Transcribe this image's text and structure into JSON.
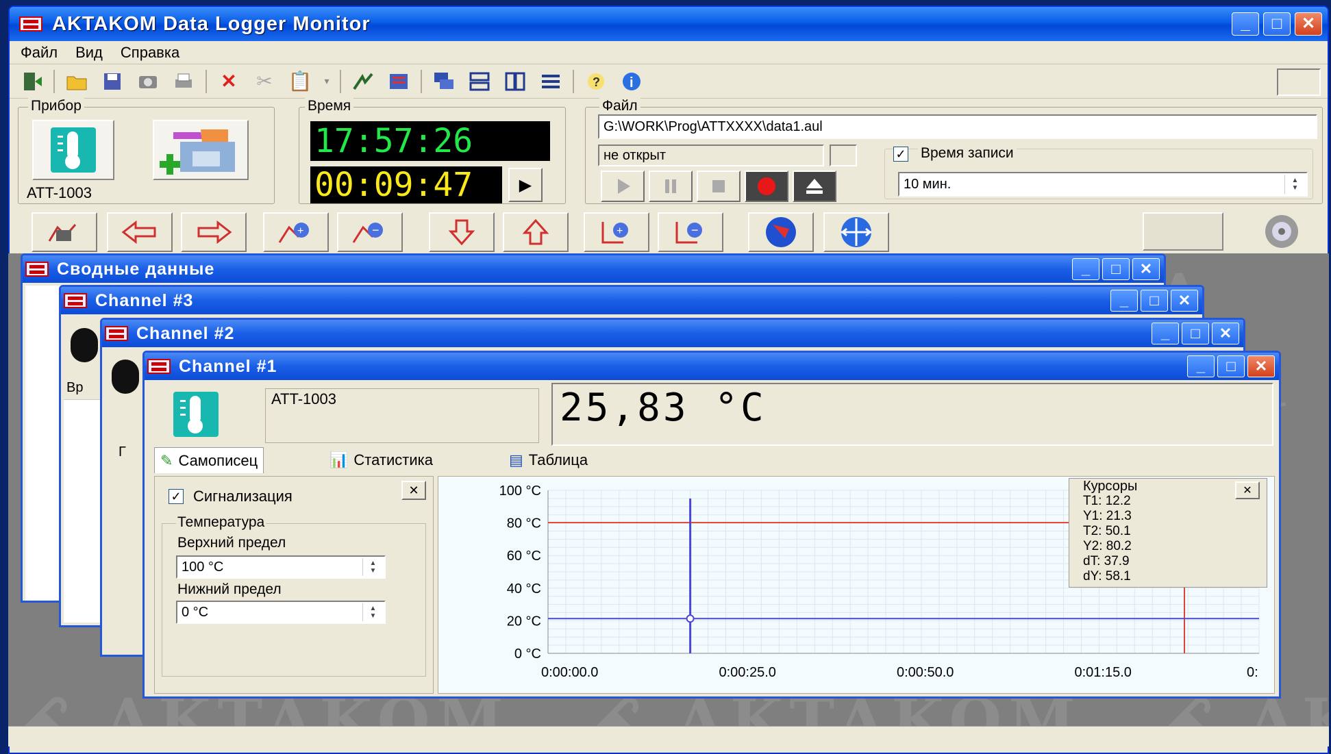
{
  "app": {
    "title": "AKTAKOM Data Logger Monitor"
  },
  "titlebar_buttons": {
    "minimize": "_",
    "maximize": "□",
    "close": "✕"
  },
  "menu": [
    "Файл",
    "Вид",
    "Справка"
  ],
  "device_panel": {
    "label": "Прибор",
    "device_name": "ATT-1003"
  },
  "time_panel": {
    "label": "Время",
    "clock": "17:57:26",
    "elapsed": "00:09:47",
    "play_glyph": "▶"
  },
  "file_panel": {
    "label": "Файл",
    "path": "G:\\WORK\\Prog\\ATTXXXX\\data1.aul",
    "status": "не открыт",
    "record_time_checked": true,
    "record_time_label": "Время записи",
    "record_time_value": "10 мин."
  },
  "mdi_windows": [
    {
      "title": "Сводные данные"
    },
    {
      "title": "Channel #3"
    },
    {
      "title": "Channel #2"
    }
  ],
  "behind_fragments": {
    "vr": "Вр",
    "g1": "Г",
    "g2": "Г"
  },
  "channel1": {
    "title": "Channel #1",
    "device": "ATT-1003",
    "reading": "25,83 °C",
    "tabs": [
      "Самописец",
      "Статистика",
      "Таблица"
    ],
    "alarm_checked": true,
    "alarm_label": "Сигнализация",
    "close_glyph": "✕",
    "temp_group": "Температура",
    "upper_label": "Верхний предел",
    "upper_value": "100 °C",
    "lower_label": "Нижний предел",
    "lower_value": "0 °C",
    "cursors": {
      "title": "Курсоры",
      "lines": [
        "T1: 12.2",
        "Y1: 21.3",
        "T2: 50.1",
        "Y2: 80.2",
        "dT: 37.9",
        "dY: 58.1"
      ]
    }
  },
  "colors": {
    "titlebar": "#0a5ee8",
    "lcd_green": "#22e84a",
    "lcd_yellow": "#f8e81c",
    "cursor_red": "#e0403a",
    "cursor_blue": "#4848d8",
    "thermo": "#18b8b0"
  },
  "chart_data": {
    "type": "line",
    "yticks": [
      "100 °C",
      "80 °C",
      "60 °C",
      "40 °C",
      "20 °C",
      "0 °C"
    ],
    "ytick_values": [
      100,
      80,
      60,
      40,
      20,
      0
    ],
    "xticks": [
      "0:00:00.0",
      "0:00:25.0",
      "0:00:50.0",
      "0:01:15.0",
      "0:"
    ],
    "xtick_values": [
      0,
      25,
      50,
      75,
      100
    ],
    "ylim": [
      0,
      100
    ],
    "xlim": [
      0,
      100
    ],
    "cursor1": {
      "t": 12.2,
      "y": 21.3
    },
    "cursor2": {
      "t": 50.1,
      "y": 80.2
    },
    "red_vertical_t": 89.5,
    "blue_vertical_t": 20.0,
    "grid": true
  }
}
